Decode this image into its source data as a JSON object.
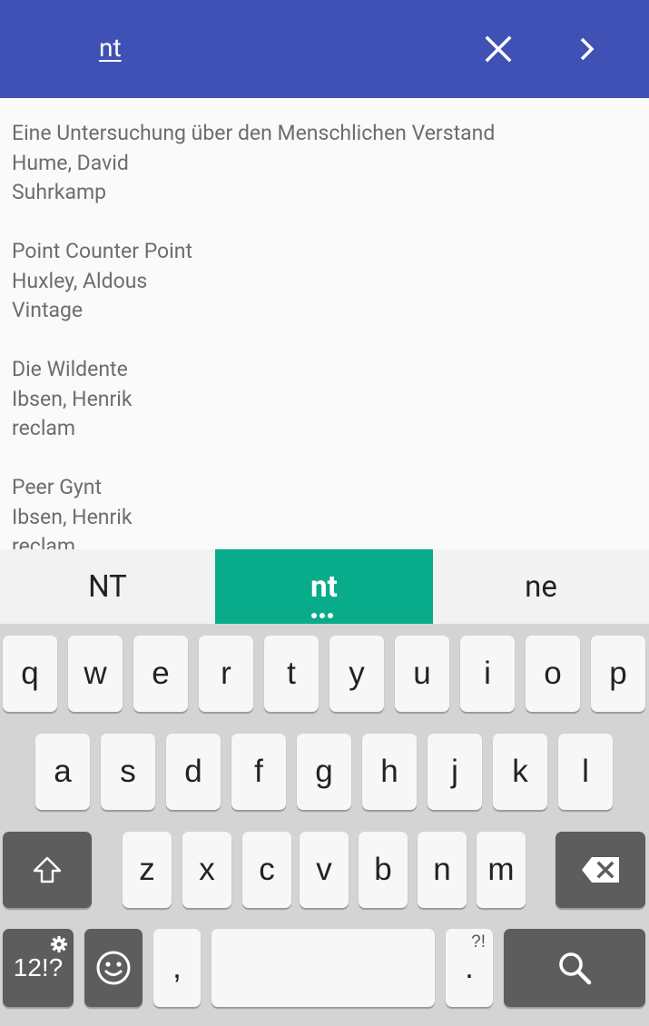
{
  "search": {
    "query": "nt",
    "clear_icon": "close-icon",
    "next_icon": "chevron-right-icon"
  },
  "results": [
    {
      "title": "Eine Untersuchung über den Menschlichen Verstand",
      "author": "Hume, David",
      "publisher": "Suhrkamp"
    },
    {
      "title": "Point Counter Point",
      "author": "Huxley, Aldous",
      "publisher": "Vintage"
    },
    {
      "title": "Die Wildente",
      "author": "Ibsen, Henrik",
      "publisher": "reclam"
    },
    {
      "title": "Peer Gynt",
      "author": "Ibsen, Henrik",
      "publisher": "reclam"
    }
  ],
  "suggestions": [
    "NT",
    "nt",
    "ne"
  ],
  "keyboard": {
    "row1": [
      "q",
      "w",
      "e",
      "r",
      "t",
      "y",
      "u",
      "i",
      "o",
      "p"
    ],
    "row2": [
      "a",
      "s",
      "d",
      "f",
      "g",
      "h",
      "j",
      "k",
      "l"
    ],
    "row3": [
      "z",
      "x",
      "c",
      "v",
      "b",
      "n",
      "m"
    ],
    "symbols_label": "12!?",
    "comma": ",",
    "period": ".",
    "period_alt": "?!",
    "shift_icon": "shift-arrow-icon",
    "backspace_icon": "backspace-icon",
    "settings_icon": "gear-icon",
    "emoji_icon": "smiley-icon",
    "search_icon": "search-icon",
    "colors": {
      "appbar": "#3f51b5",
      "suggestion_highlight": "#09ac8a"
    }
  }
}
